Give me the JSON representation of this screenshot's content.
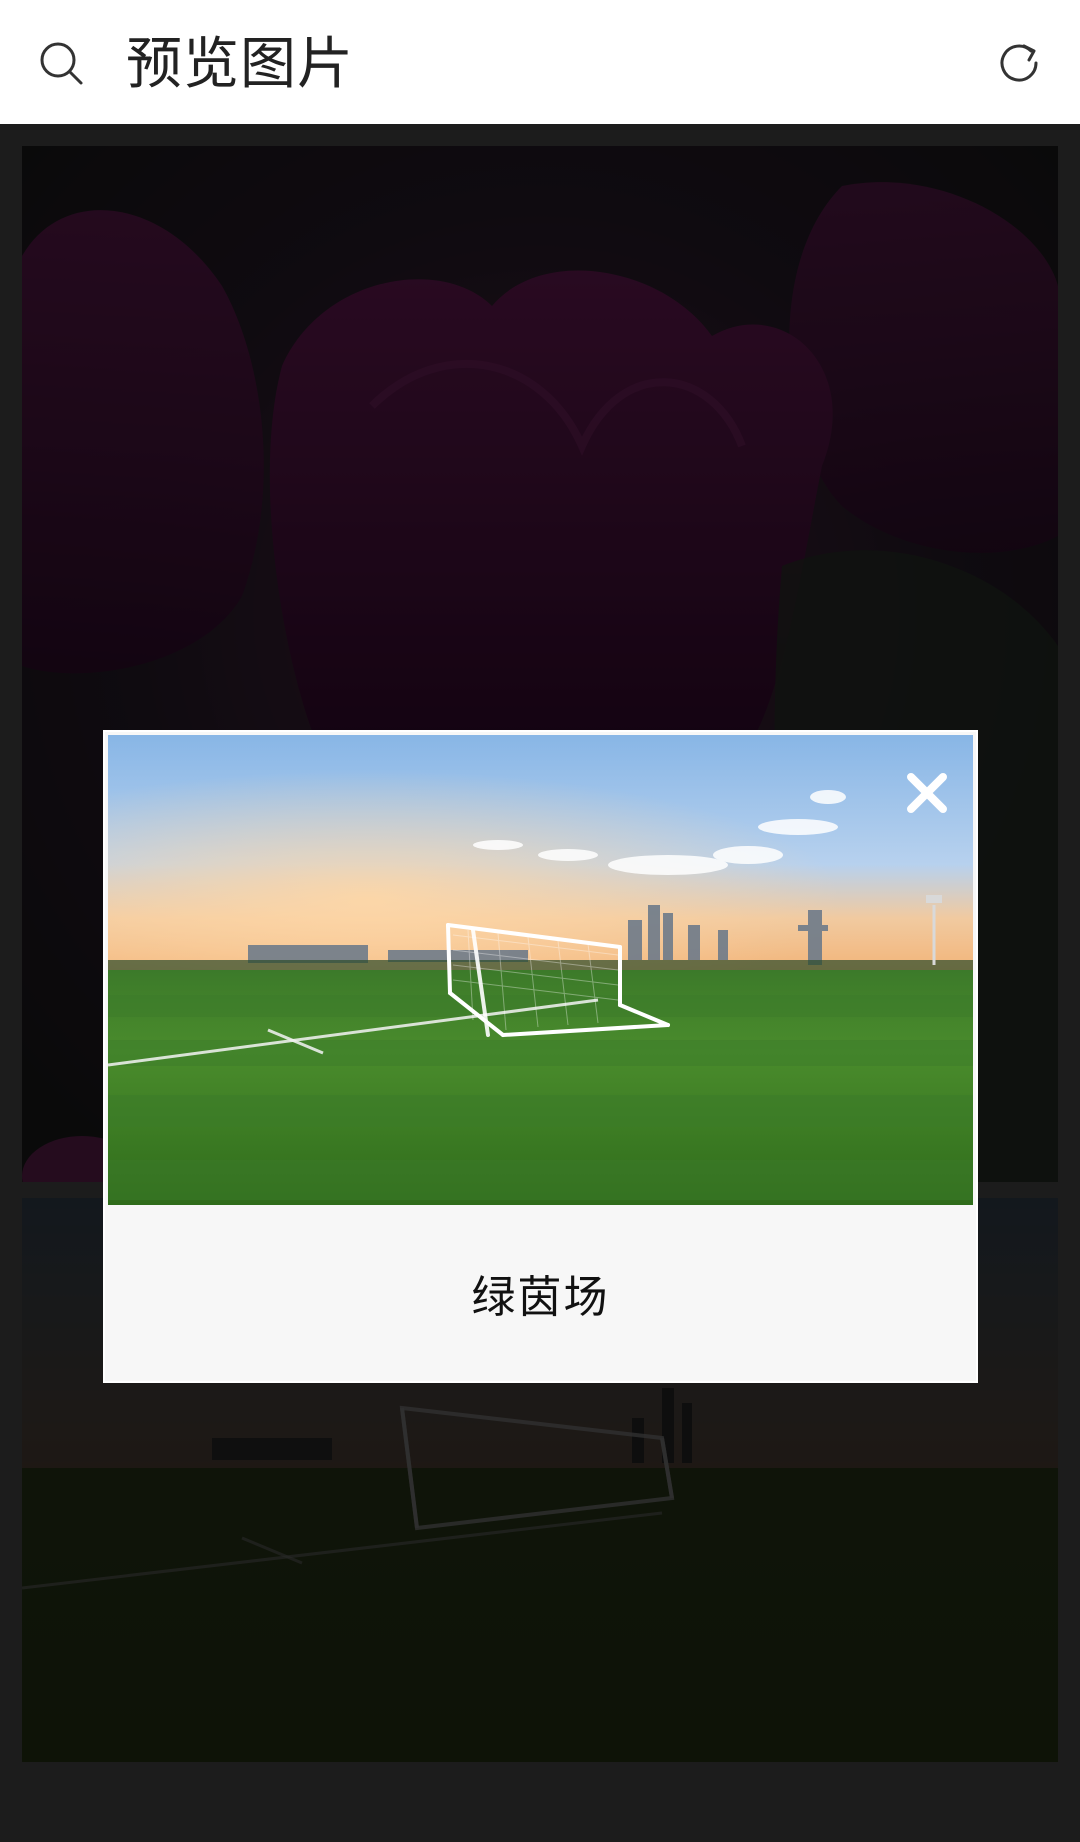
{
  "header": {
    "title": "预览图片",
    "search_icon": "search-icon",
    "refresh_icon": "refresh-icon"
  },
  "gallery": {
    "items": [
      {
        "kind": "photo",
        "subject": "tulips"
      },
      {
        "kind": "photo",
        "subject": "soccer-field"
      }
    ]
  },
  "modal": {
    "caption": "绿茵场",
    "close_icon": "close-icon"
  },
  "colors": {
    "header_bg": "#ffffff",
    "overlay": "#3f3f3f",
    "modal_bg": "#f7f7f7"
  }
}
